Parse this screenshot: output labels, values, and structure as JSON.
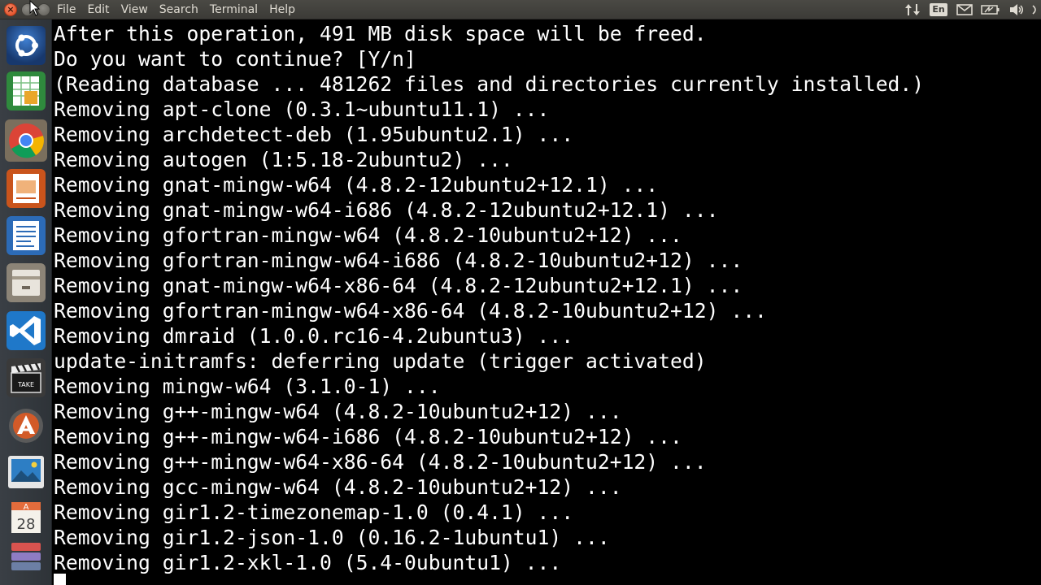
{
  "menubar": {
    "items": [
      "File",
      "Edit",
      "View",
      "Search",
      "Terminal",
      "Help"
    ],
    "keyboard_layout": "En",
    "tray_icons": [
      "network-updown-icon",
      "keyboard-layout-icon",
      "mail-icon",
      "battery-icon",
      "volume-icon"
    ]
  },
  "launcher": {
    "apps": [
      {
        "name": "ubuntu-dash-icon",
        "color": "#1e4b8a"
      },
      {
        "name": "libreoffice-calc-icon",
        "color": "#2f8a3d"
      },
      {
        "name": "chrome-icon",
        "color": "#e84335"
      },
      {
        "name": "libreoffice-impress-icon",
        "color": "#c9541c"
      },
      {
        "name": "libreoffice-writer-icon",
        "color": "#2c6bb7"
      },
      {
        "name": "file-manager-icon",
        "color": "#8c8477"
      },
      {
        "name": "vscode-icon",
        "color": "#1f78c9"
      },
      {
        "name": "video-editor-clapper-icon",
        "color": "#3a3a3a"
      },
      {
        "name": "software-updater-icon",
        "color": "#d25a28"
      },
      {
        "name": "image-viewer-icon",
        "color": "#2d7ec4"
      },
      {
        "name": "calendar-icon",
        "color": "#e36c3c",
        "text": "28"
      },
      {
        "name": "app-stack-icon",
        "color": "#6c7fa5"
      }
    ]
  },
  "terminal": {
    "lines": [
      "After this operation, 491 MB disk space will be freed.",
      "Do you want to continue? [Y/n]",
      "(Reading database ... 481262 files and directories currently installed.)",
      "Removing apt-clone (0.3.1~ubuntu11.1) ...",
      "Removing archdetect-deb (1.95ubuntu2.1) ...",
      "Removing autogen (1:5.18-2ubuntu2) ...",
      "Removing gnat-mingw-w64 (4.8.2-12ubuntu2+12.1) ...",
      "Removing gnat-mingw-w64-i686 (4.8.2-12ubuntu2+12.1) ...",
      "Removing gfortran-mingw-w64 (4.8.2-10ubuntu2+12) ...",
      "Removing gfortran-mingw-w64-i686 (4.8.2-10ubuntu2+12) ...",
      "Removing gnat-mingw-w64-x86-64 (4.8.2-12ubuntu2+12.1) ...",
      "Removing gfortran-mingw-w64-x86-64 (4.8.2-10ubuntu2+12) ...",
      "Removing dmraid (1.0.0.rc16-4.2ubuntu3) ...",
      "update-initramfs: deferring update (trigger activated)",
      "Removing mingw-w64 (3.1.0-1) ...",
      "Removing g++-mingw-w64 (4.8.2-10ubuntu2+12) ...",
      "Removing g++-mingw-w64-i686 (4.8.2-10ubuntu2+12) ...",
      "Removing g++-mingw-w64-x86-64 (4.8.2-10ubuntu2+12) ...",
      "Removing gcc-mingw-w64 (4.8.2-10ubuntu2+12) ...",
      "Removing gir1.2-timezonemap-1.0 (0.4.1) ...",
      "Removing gir1.2-json-1.0 (0.16.2-1ubuntu1) ...",
      "Removing gir1.2-xkl-1.0 (5.4-0ubuntu1) ..."
    ]
  }
}
